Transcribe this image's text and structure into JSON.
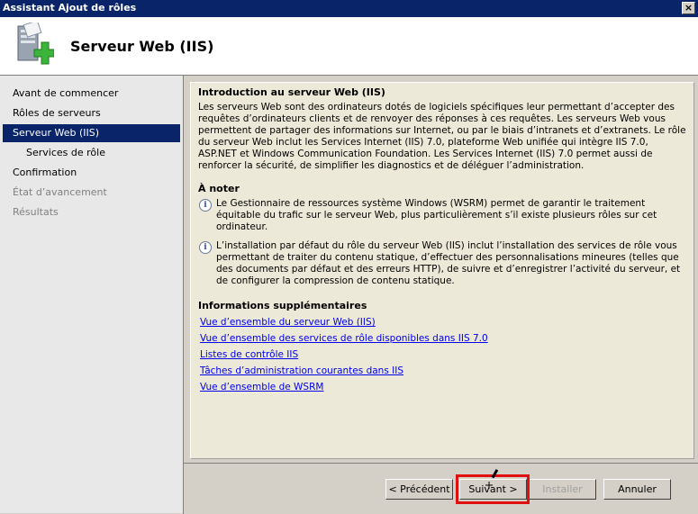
{
  "window": {
    "title": "Assistant Ajout de rôles",
    "close_label": "×"
  },
  "header": {
    "title": "Serveur Web (IIS)",
    "icon": "server-add-icon"
  },
  "nav": {
    "items": [
      {
        "label": "Avant de commencer",
        "state": "normal"
      },
      {
        "label": "Rôles de serveurs",
        "state": "normal"
      },
      {
        "label": "Serveur Web (IIS)",
        "state": "active"
      },
      {
        "label": "Services de rôle",
        "state": "sub"
      },
      {
        "label": "Confirmation",
        "state": "normal"
      },
      {
        "label": "État d’avancement",
        "state": "disabled"
      },
      {
        "label": "Résultats",
        "state": "disabled"
      }
    ]
  },
  "content": {
    "intro_heading": "Introduction au serveur Web (IIS)",
    "intro_text": "Les serveurs Web sont des ordinateurs dotés de logiciels spécifiques leur permettant d’accepter des requêtes d’ordinateurs clients et de renvoyer des réponses à ces requêtes. Les serveurs Web vous permettent de partager des informations sur Internet, ou par le biais d’intranets et d’extranets. Le rôle du serveur Web inclut les Services Internet (IIS) 7.0, plateforme Web unifiée qui intègre IIS 7.0, ASP.NET et Windows Communication Foundation. Les Services Internet (IIS) 7.0 permet aussi de renforcer la sécurité, de simplifier les diagnostics et de déléguer l’administration.",
    "note_heading": "À noter",
    "notes": [
      "Le Gestionnaire de ressources système Windows (WSRM) permet de garantir le traitement équitable du trafic sur le serveur Web, plus particulièrement s’il existe plusieurs rôles sur cet ordinateur.",
      "L’installation par défaut du rôle du serveur Web (IIS) inclut l’installation des services de rôle vous permettant de traiter du contenu statique, d’effectuer des personnalisations mineures (telles que des documents par défaut et des erreurs HTTP), de suivre et d’enregistrer l’activité du serveur, et de configurer la compression de contenu statique."
    ],
    "info_heading": "Informations supplémentaires",
    "links": [
      "Vue d’ensemble du serveur Web (IIS)",
      "Vue d’ensemble des services de rôle disponibles dans IIS 7.0",
      "Listes de contrôle IIS",
      "Tâches d’administration courantes dans IIS",
      "Vue d’ensemble de WSRM"
    ]
  },
  "buttons": {
    "previous": "< Précédent",
    "next": "Suivant >",
    "install": "Installer",
    "cancel": "Annuler"
  },
  "colors": {
    "titlebar": "#0a246a",
    "highlight_box": "#e01010",
    "link": "#0000ee"
  }
}
